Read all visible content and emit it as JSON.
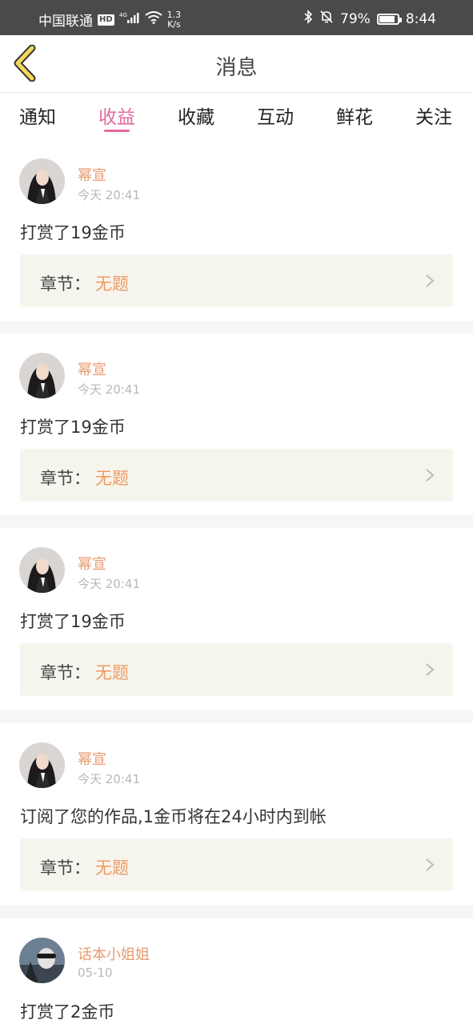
{
  "status_bar": {
    "carrier": "中国联通",
    "hd": "HD",
    "network": "4G",
    "speed_value": "1.3",
    "speed_unit": "K/s",
    "battery": "79%",
    "time": "8:44"
  },
  "header": {
    "title": "消息"
  },
  "tabs": [
    {
      "label": "通知"
    },
    {
      "label": "收益"
    },
    {
      "label": "收藏"
    },
    {
      "label": "互动"
    },
    {
      "label": "鲜花"
    },
    {
      "label": "关注"
    }
  ],
  "active_tab": 1,
  "colors": {
    "accent_pink": "#e46aa0",
    "name_orange": "#e89a6e",
    "chapter_orange": "#ee9a63"
  },
  "messages": [
    {
      "user": "幂宣",
      "time": "今天 20:41",
      "text": "打赏了19金币",
      "chapter_label": "章节：",
      "chapter_title": "无题"
    },
    {
      "user": "幂宣",
      "time": "今天 20:41",
      "text": "打赏了19金币",
      "chapter_label": "章节：",
      "chapter_title": "无题"
    },
    {
      "user": "幂宣",
      "time": "今天 20:41",
      "text": "打赏了19金币",
      "chapter_label": "章节：",
      "chapter_title": "无题"
    },
    {
      "user": "幂宣",
      "time": "今天 20:41",
      "text": "订阅了您的作品,1金币将在24小时内到帐",
      "chapter_label": "章节：",
      "chapter_title": "无题"
    },
    {
      "user": "话本小姐姐",
      "time": "05-10",
      "text": "打赏了2金币"
    }
  ]
}
